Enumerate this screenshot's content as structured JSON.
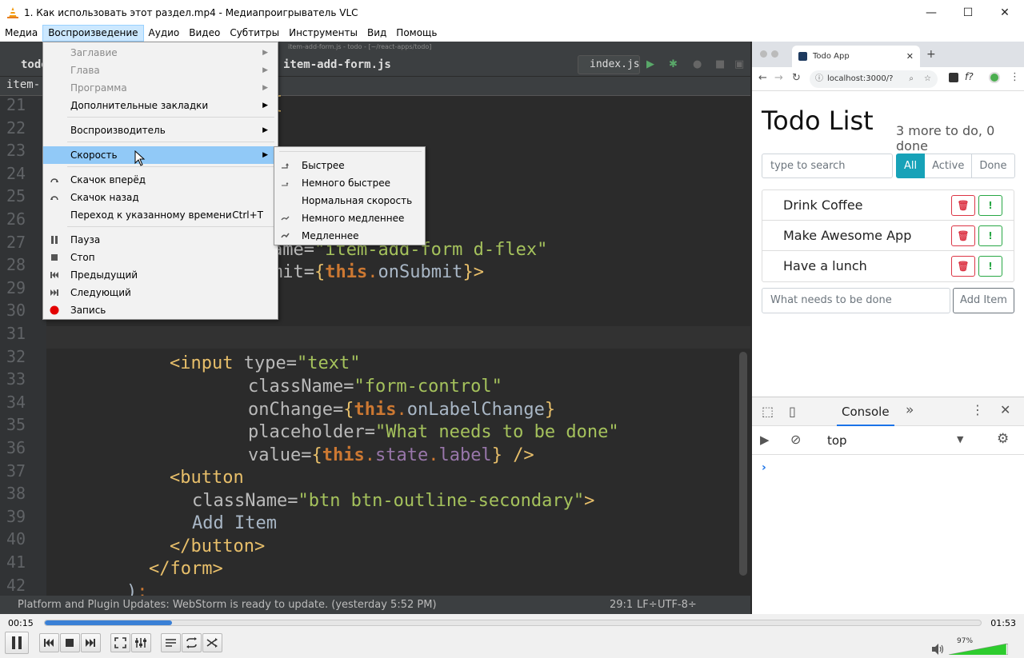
{
  "window": {
    "title": "1. Как использовать этот раздел.mp4 - Медиапроигрыватель VLC",
    "minimize": "—",
    "maximize": "☐",
    "close": "✕"
  },
  "menubar": [
    "Медиа",
    "Воспроизведение",
    "Аудио",
    "Видео",
    "Субтитры",
    "Инструменты",
    "Вид",
    "Помощь"
  ],
  "playback_menu": {
    "items": [
      {
        "label": "Заглавие",
        "disabled": true,
        "submenu": true
      },
      {
        "label": "Глава",
        "disabled": true,
        "submenu": true
      },
      {
        "label": "Программа",
        "disabled": true,
        "submenu": true
      },
      {
        "label": "Дополнительные закладки",
        "submenu": true
      },
      {
        "label": "Воспроизводитель",
        "submenu": true
      },
      {
        "label": "Скорость",
        "submenu": true,
        "highlighted": true
      },
      {
        "label": "Скачок вперёд",
        "icon": "jump-forward-icon"
      },
      {
        "label": "Скачок назад",
        "icon": "jump-back-icon"
      },
      {
        "label": "Переход к указанному времени",
        "shortcut": "Ctrl+T"
      },
      {
        "label": "Пауза",
        "icon": "pause-icon"
      },
      {
        "label": "Стоп",
        "icon": "stop-icon"
      },
      {
        "label": "Предыдущий",
        "icon": "previous-icon"
      },
      {
        "label": "Следующий",
        "icon": "next-icon"
      },
      {
        "label": "Запись",
        "icon": "record-icon"
      }
    ]
  },
  "speed_menu": {
    "items": [
      {
        "label": "Быстрее",
        "icon": "faster-icon"
      },
      {
        "label": "Немного быстрее",
        "icon": "faster-fine-icon"
      },
      {
        "label": "Нормальная скорость"
      },
      {
        "label": "Немного медленнее",
        "icon": "slower-fine-icon"
      },
      {
        "label": "Медленнее",
        "icon": "slower-icon"
      }
    ]
  },
  "ide": {
    "small_title": "item-add-form.js - todo - [~/react-apps/todo]",
    "tab_left": "todo",
    "tab_file": "item-add-form.js",
    "tab_sub": "item-",
    "run_config": "index.js",
    "line_numbers": [
      "21",
      "22",
      "23",
      "24",
      "25",
      "26",
      "27",
      "28",
      "29",
      "30",
      "31",
      "32",
      "33",
      "34",
      "35",
      "36",
      "37",
      "38",
      "39",
      "40",
      "41",
      "42"
    ],
    "status": "Platform and Plugin Updates: WebStorm is ready to update. (yesterday 5:52 PM)",
    "position": "29:1",
    "lf": "LF÷",
    "encoding": "UTF-8÷"
  },
  "browser": {
    "tab_title": "Todo App",
    "url": "localhost:3000/?",
    "title": "Todo List",
    "count": "3 more to do, 0 done",
    "search_placeholder": "type to search",
    "filters": [
      "All",
      "Active",
      "Done"
    ],
    "items": [
      "Drink Coffee",
      "Make Awesome App",
      "Have a lunch"
    ],
    "add_placeholder": "What needs to be done",
    "add_button": "Add Item",
    "devtools": {
      "tab": "Console",
      "more": "»",
      "context": "top",
      "prompt": "›"
    }
  },
  "player": {
    "elapsed": "00:15",
    "total": "01:53",
    "progress": 0.136,
    "volume_label": "97%",
    "volume": 0.97
  },
  "colors": {
    "menu_highlight": "#91c9f7",
    "progress": "#3a80d6",
    "volume": "#2ecc2e",
    "teal": "#17a2b8"
  }
}
